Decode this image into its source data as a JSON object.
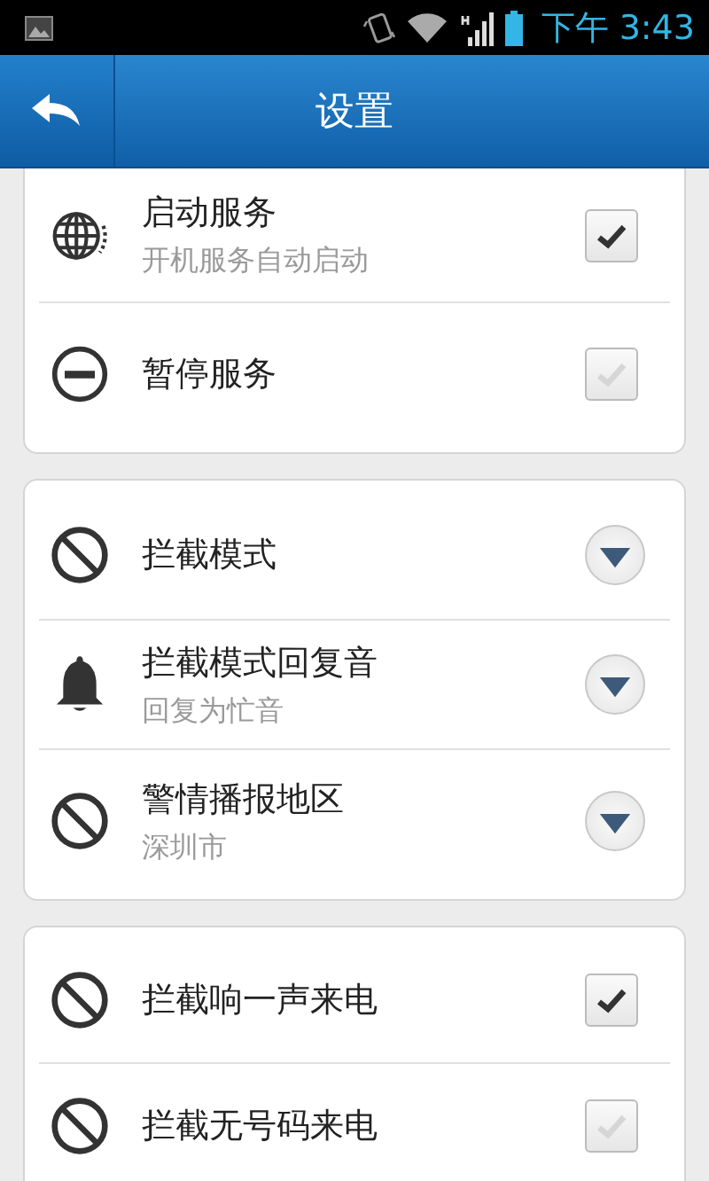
{
  "status_bar": {
    "time": "下午 3:43"
  },
  "header": {
    "title": "设置"
  },
  "sections": [
    {
      "rows": [
        {
          "kind": "checkbox",
          "title": "启动服务",
          "subtitle": "开机服务自动启动",
          "checked": true
        },
        {
          "kind": "checkbox",
          "title": "暂停服务",
          "checked": false
        }
      ]
    },
    {
      "rows": [
        {
          "kind": "dropdown",
          "title": "拦截模式"
        },
        {
          "kind": "dropdown",
          "title": "拦截模式回复音",
          "subtitle": "回复为忙音"
        },
        {
          "kind": "dropdown",
          "title": "警情播报地区",
          "subtitle": "深圳市"
        }
      ]
    },
    {
      "rows": [
        {
          "kind": "checkbox",
          "title": "拦截响一声来电",
          "checked": true
        },
        {
          "kind": "checkbox",
          "title": "拦截无号码来电",
          "checked": false
        }
      ]
    }
  ]
}
